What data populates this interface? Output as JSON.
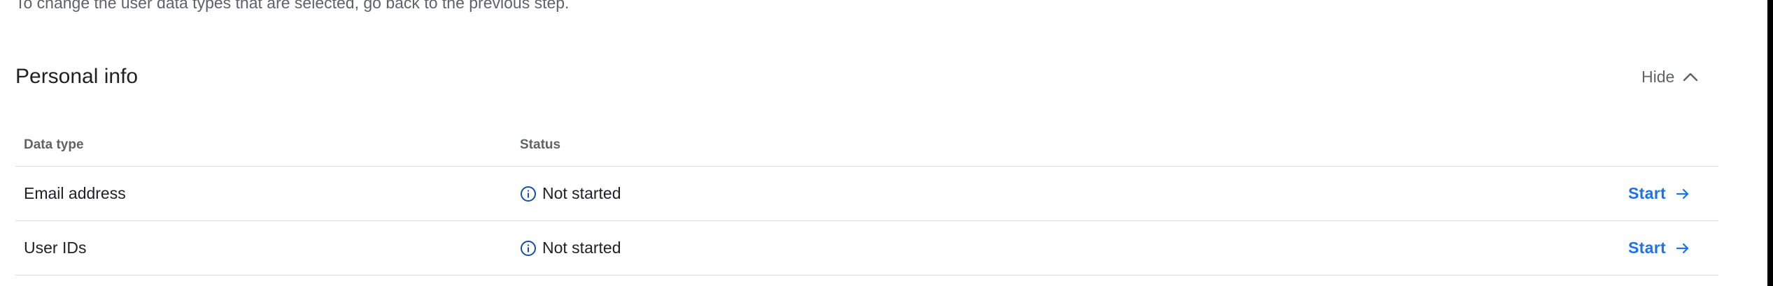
{
  "instruction": "To change the user data types that are selected, go back to the previous step.",
  "section": {
    "title": "Personal info",
    "toggle_label": "Hide",
    "toggle_icon": "chevron-up-icon"
  },
  "table": {
    "headers": {
      "data_type": "Data type",
      "status": "Status"
    },
    "rows": [
      {
        "data_type": "Email address",
        "status": "Not started",
        "status_icon": "info-icon",
        "action_label": "Start",
        "action_icon": "arrow-right-icon"
      },
      {
        "data_type": "User IDs",
        "status": "Not started",
        "status_icon": "info-icon",
        "action_label": "Start",
        "action_icon": "arrow-right-icon"
      }
    ]
  },
  "colors": {
    "text_primary": "#202124",
    "text_secondary": "#5f6368",
    "link": "#1a73e8",
    "status_icon": "#174ea6",
    "divider": "#dadce0"
  }
}
